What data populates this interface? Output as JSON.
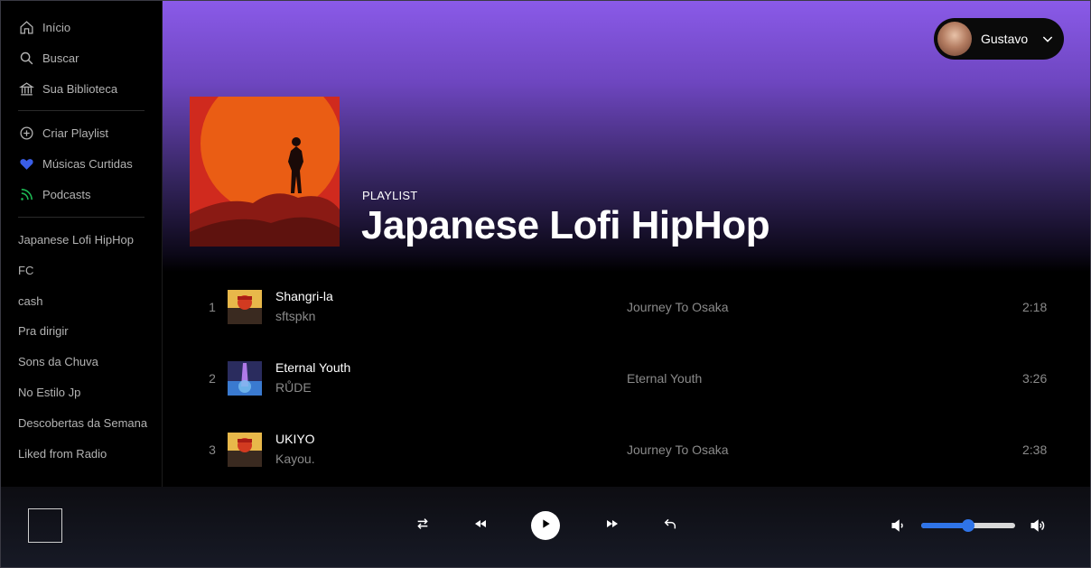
{
  "sidebar": {
    "nav": [
      {
        "label": "Início",
        "icon": "home-icon"
      },
      {
        "label": "Buscar",
        "icon": "search-icon"
      },
      {
        "label": "Sua Biblioteca",
        "icon": "library-icon"
      }
    ],
    "actions": [
      {
        "label": "Criar Playlist",
        "icon": "plus-circle-icon"
      },
      {
        "label": "Músicas Curtidas",
        "icon": "heart-icon",
        "color": "#3a5ee8"
      },
      {
        "label": "Podcasts",
        "icon": "podcast-icon",
        "color": "#1db954"
      }
    ],
    "playlists": [
      "Japanese Lofi HipHop",
      "FC",
      "cash",
      "Pra dirigir",
      "Sons da Chuva",
      "No Estilo Jp",
      "Descobertas da Semana",
      "Liked from Radio"
    ]
  },
  "header": {
    "user_name": "Gustavo",
    "gradient_color": "#8a5ae8"
  },
  "playlist": {
    "type": "PLAYLIST",
    "title": "Japanese Lofi HipHop"
  },
  "tracks": [
    {
      "number": "1",
      "title": "Shangri-la",
      "artist": "sftspkn",
      "album": "Journey To Osaka",
      "duration": "2:18"
    },
    {
      "number": "2",
      "title": "Eternal Youth",
      "artist": "RŮDE",
      "album": "Eternal Youth",
      "duration": "3:26"
    },
    {
      "number": "3",
      "title": "UKIYO",
      "artist": "Kayou.",
      "album": "Journey To Osaka",
      "duration": "2:38"
    }
  ],
  "player": {
    "volume_percent": 50,
    "accent_color": "#2f74e8",
    "controls": [
      "shuffle-icon",
      "previous-icon",
      "play-icon",
      "next-icon",
      "back-icon"
    ]
  }
}
